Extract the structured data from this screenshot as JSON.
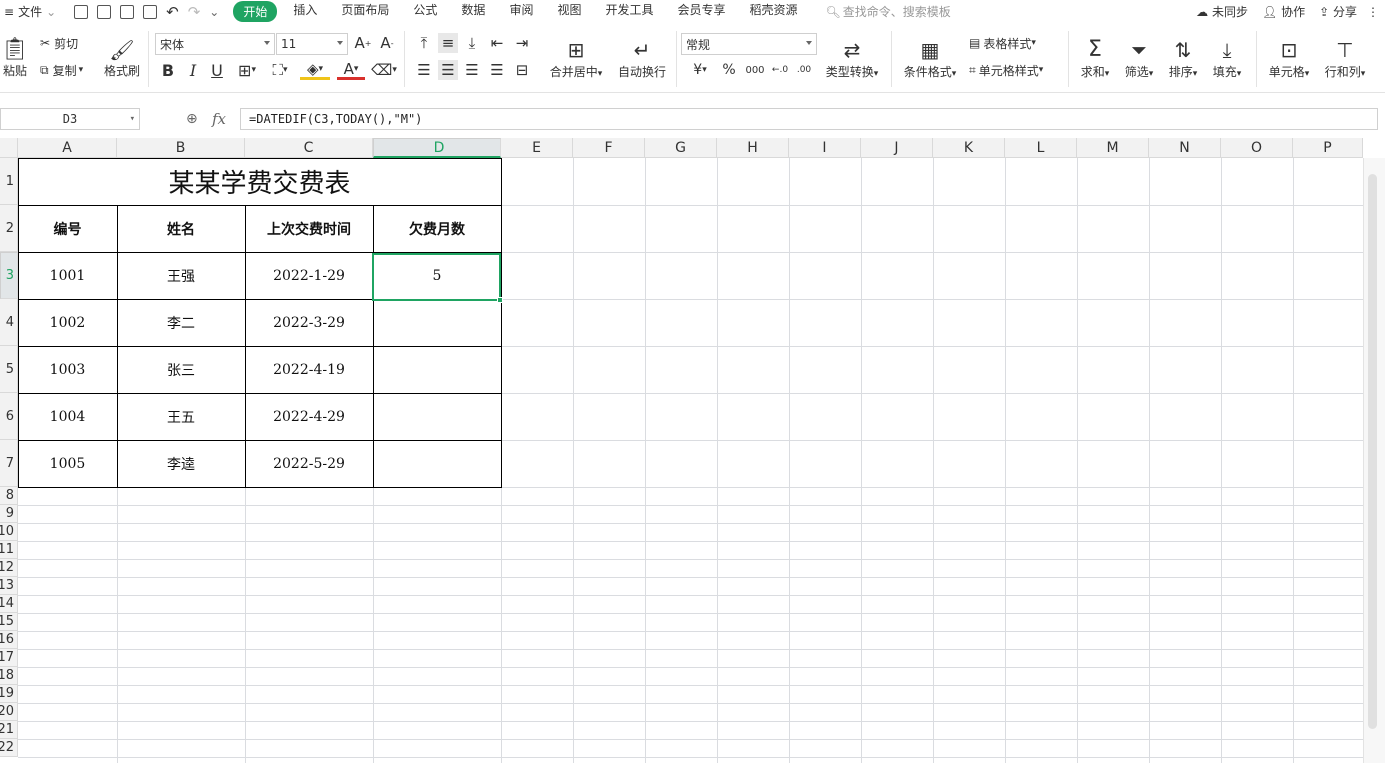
{
  "menu": {
    "file": "文件",
    "tabs": [
      "开始",
      "插入",
      "页面布局",
      "公式",
      "数据",
      "审阅",
      "视图",
      "开发工具",
      "会员专享",
      "稻壳资源"
    ],
    "search_placeholder": "查找命令、搜索模板",
    "sync": "未同步",
    "collab": "协作",
    "share": "分享"
  },
  "ribbon": {
    "paste": "粘贴",
    "cut": "剪切",
    "copy": "复制",
    "format_painter": "格式刷",
    "font_name": "宋体",
    "font_size": "11",
    "merge_center": "合并居中",
    "wrap_text": "自动换行",
    "number_format": "常规",
    "currency": "¥",
    "percent": "%",
    "thousands": "000",
    "type_convert": "类型转换",
    "cond_format": "条件格式",
    "table_style": "表格样式",
    "cell_style": "单元格样式",
    "sum": "求和",
    "filter": "筛选",
    "sort": "排序",
    "fill": "填充",
    "cell": "单元格",
    "row_col": "行和列"
  },
  "formula_bar": {
    "name_box": "D3",
    "fx": "fx",
    "formula": "=DATEDIF(C3,TODAY(),\"M\")"
  },
  "columns": [
    "A",
    "B",
    "C",
    "D",
    "E",
    "F",
    "G",
    "H",
    "I",
    "J",
    "K",
    "L",
    "M",
    "N",
    "O",
    "P"
  ],
  "rows": [
    "1",
    "2",
    "3",
    "4",
    "5",
    "6",
    "7",
    "8",
    "9",
    "10",
    "11",
    "12",
    "13",
    "14",
    "15",
    "16",
    "17",
    "18",
    "19",
    "20",
    "21",
    "22"
  ],
  "sheet": {
    "title": "某某学费交费表",
    "headers": [
      "编号",
      "姓名",
      "上次交费时间",
      "欠费月数"
    ],
    "records": [
      [
        "1001",
        "王强",
        "2022-1-29",
        "5"
      ],
      [
        "1002",
        "李二",
        "2022-3-29",
        ""
      ],
      [
        "1003",
        "张三",
        "2022-4-19",
        ""
      ],
      [
        "1004",
        "王五",
        "2022-4-29",
        ""
      ],
      [
        "1005",
        "李逵",
        "2022-5-29",
        ""
      ]
    ]
  },
  "colors": {
    "accent": "#1fa462",
    "grid": "#dadce0",
    "header_bg": "#f2f2f2"
  }
}
